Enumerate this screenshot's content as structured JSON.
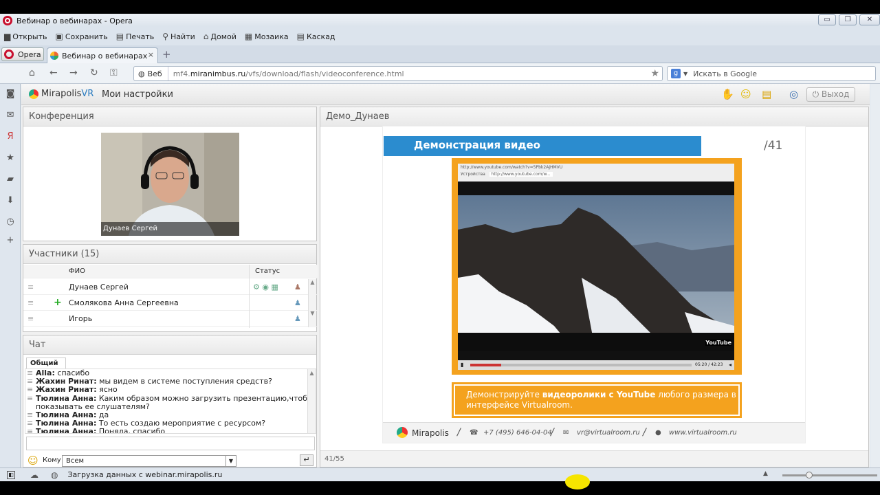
{
  "window": {
    "title": "Вебинар о вебинарах - Opera",
    "btn_min": "▭",
    "btn_max": "❐",
    "btn_close": "✕"
  },
  "menubar": [
    {
      "label": "Открыть",
      "icon": "folder-icon",
      "glyph": "▆"
    },
    {
      "label": "Сохранить",
      "icon": "save-icon",
      "glyph": "▣"
    },
    {
      "label": "Печать",
      "icon": "printer-icon",
      "glyph": "▤"
    },
    {
      "label": "Найти",
      "icon": "magnifier-icon",
      "glyph": "⚲"
    },
    {
      "label": "Домой",
      "icon": "home-icon",
      "glyph": "⌂"
    },
    {
      "label": "Мозаика",
      "icon": "tile-icon",
      "glyph": "▦"
    },
    {
      "label": "Каскад",
      "icon": "cascade-icon",
      "glyph": "▤"
    }
  ],
  "tabs": {
    "opera_label": "Opera",
    "active_tab": "Вебинар о вебинарах",
    "close": "×",
    "new_tab": "+"
  },
  "address": {
    "web_label": "Веб",
    "url_prefix": "mf4.",
    "url_domain": "miranimbus.ru",
    "url_path": "/vfs/download/flash/videoconference.html",
    "search_engine_badge": "g",
    "search_placeholder": "Искать в Google"
  },
  "statusbar": {
    "text": "Загрузка данных с webinar.mirapolis.ru"
  },
  "app": {
    "logo_main": "Mirapolis",
    "logo_vr": "VR",
    "settings_label": "Мои настройки",
    "exit_label": "Выход",
    "conference": {
      "title": "Конференция",
      "camera_name": "Дунаев Сергей"
    },
    "participants": {
      "title": "Участники (15)",
      "col_name": "ФИО",
      "col_status": "Статус",
      "rows": [
        {
          "name": "Дунаев Сергей"
        },
        {
          "name": "Смолякова Анна Сергеевна"
        },
        {
          "name": "Игорь"
        }
      ]
    },
    "chat": {
      "title": "Чат",
      "tab": "Общий",
      "to_label": "Кому",
      "to_value": "Всем",
      "messages": [
        {
          "author": "Alla:",
          "text": "спасибо"
        },
        {
          "author": "Жахин Ринат:",
          "text": "мы видем в системе поступления средств?"
        },
        {
          "author": "Жахин Ринат:",
          "text": "ясно"
        },
        {
          "author": "Тюлина Анна:",
          "text": "Каким образом можно загрузить презентацию,чтоб показывать ее слушателям?"
        },
        {
          "author": "Тюлина Анна:",
          "text": "да"
        },
        {
          "author": "Тюлина Анна:",
          "text": "То есть создаю мероприятие с ресурсом?"
        },
        {
          "author": "Тюлина Анна:",
          "text": "Поняла, спасибо"
        }
      ]
    },
    "demo": {
      "title": "Демо_Дунаев",
      "slide_title": "Демонстрация видео",
      "slide_number": "41",
      "video_url": "http://www.youtube.com/watch?v=5Pbk2AjHMVU",
      "video_tab": "http://www.youtube.com/w...",
      "video_tab_left": "Устройства",
      "video_time": "05:20 / 42:23",
      "youtube_badge": "YouTube",
      "caption_pre": "Демонстрируйте ",
      "caption_bold": "видеоролики с YouTube",
      "caption_post": " любого размера в интерфейсе Virtualroom.",
      "footer_brand": "Mirapolis",
      "footer_phone": "+7 (495) 646-04-04",
      "footer_email": "vr@virtualroom.ru",
      "footer_site": "www.virtualroom.ru",
      "page_counter": "41/55"
    }
  }
}
